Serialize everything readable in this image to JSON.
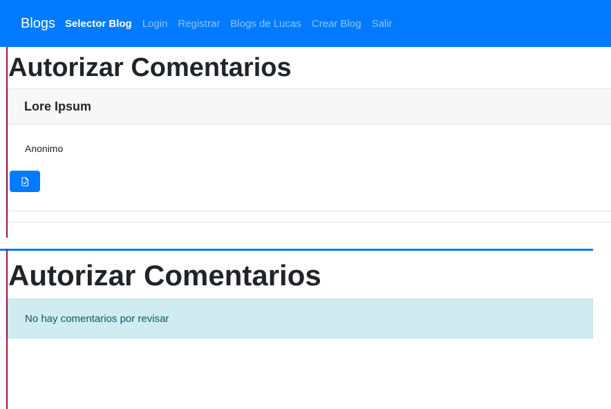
{
  "top_view": {
    "navbar": {
      "brand": "Blogs",
      "links": [
        {
          "label": "Selector Blog",
          "active": true
        },
        {
          "label": "Login",
          "active": false
        },
        {
          "label": "Registrar",
          "active": false
        },
        {
          "label": "Blogs de Lucas",
          "active": false
        },
        {
          "label": "Crear Blog",
          "active": false
        },
        {
          "label": "Salir",
          "active": false
        }
      ]
    },
    "page_title": "Autorizar Comentarios",
    "comment": {
      "title": "Lore Ipsum",
      "author": "Anonimo",
      "approve_icon": "file-check-icon"
    }
  },
  "bottom_view": {
    "page_title": "Autorizar Comentarios",
    "alert_text": "No hay comentarios por revisar"
  },
  "colors": {
    "primary": "#007bff",
    "alert_bg": "#d1ecf1",
    "alert_text": "#0c5460",
    "left_rule": "#8b1a3a"
  }
}
